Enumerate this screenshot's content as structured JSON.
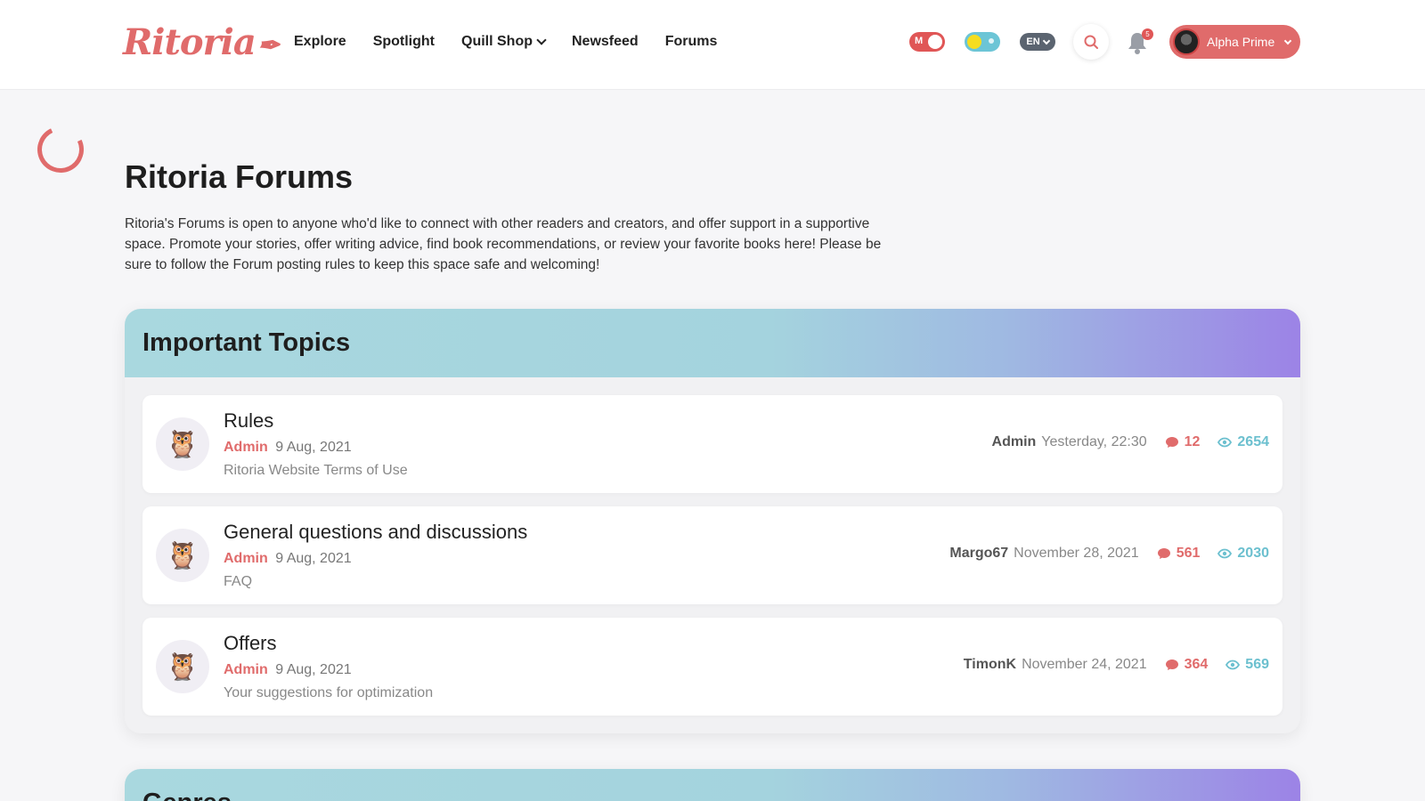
{
  "header": {
    "logo": "Ritoria",
    "nav": [
      "Explore",
      "Spotlight",
      "Quill Shop",
      "Newsfeed",
      "Forums"
    ],
    "mode_toggle": "M",
    "language": "EN",
    "notifications_count": "5",
    "user_name": "Alpha Prime"
  },
  "page": {
    "title": "Ritoria Forums",
    "intro": "Ritoria's Forums is open to anyone who'd like to connect with other readers and creators, and offer support in a supportive space. Promote your stories, offer writing advice, find book recommendations, or review your favorite books here! Please be sure to follow the Forum posting rules to keep this space safe and welcoming!"
  },
  "sections": [
    {
      "title": "Important Topics",
      "topics": [
        {
          "title": "Rules",
          "author": "Admin",
          "date": "9 Aug, 2021",
          "description": "Ritoria Website Terms of Use",
          "last_user": "Admin",
          "last_date": "Yesterday, 22:30",
          "comments": "12",
          "views": "2654",
          "icon": "owl-icon"
        },
        {
          "title": "General questions and discussions",
          "author": "Admin",
          "date": "9 Aug, 2021",
          "description": "FAQ",
          "last_user": "Margo67",
          "last_date": "November 28, 2021",
          "comments": "561",
          "views": "2030",
          "icon": "owl-icon"
        },
        {
          "title": "Offers",
          "author": "Admin",
          "date": "9 Aug, 2021",
          "description": "Your suggestions for optimization",
          "last_user": "TimonK",
          "last_date": "November 24, 2021",
          "comments": "364",
          "views": "569",
          "icon": "owl-icon"
        }
      ]
    },
    {
      "title": "Genres"
    }
  ],
  "colors": {
    "accent": "#e06b6b",
    "views": "#6cc0cf",
    "header_gradient_start": "#a9d8df",
    "header_gradient_end": "#9c83e6"
  }
}
